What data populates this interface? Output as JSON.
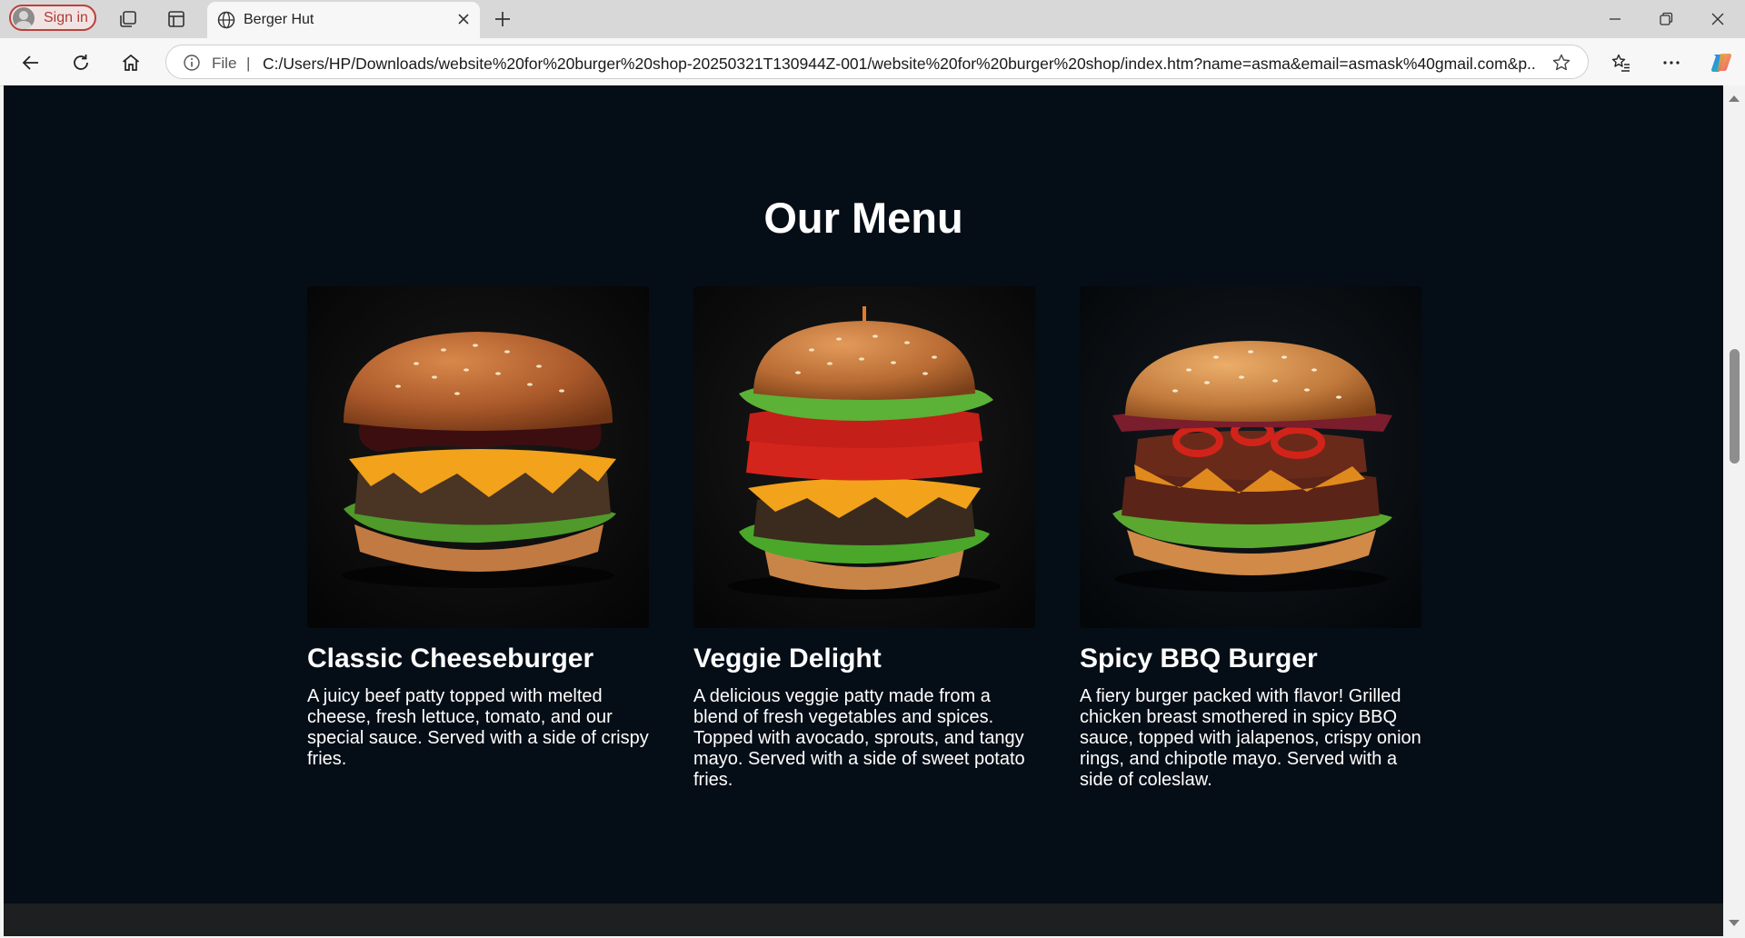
{
  "browser": {
    "profile_label": "Sign in",
    "tab_title": "Berger Hut",
    "address": {
      "scheme_label": "File",
      "separator": "|",
      "url": "C:/Users/HP/Downloads/website%20for%20burger%20shop-20250321T130944Z-001/website%20for%20burger%20shop/index.htm?name=asma&email=asmask%40gmail.com&p..."
    },
    "icons": {
      "workspaces": "workspaces-icon",
      "tab_actions": "vertical-tabs-icon",
      "tab_globe": "globe-icon",
      "tab_close": "close-icon",
      "new_tab": "plus-icon",
      "minimize": "minimize-icon",
      "restore": "restore-icon",
      "close_window": "close-icon",
      "back": "back-arrow-icon",
      "refresh": "refresh-icon",
      "home": "home-icon",
      "info": "info-icon",
      "favorite": "star-icon",
      "favorites": "favorites-icon",
      "more": "more-icon",
      "copilot": "copilot-icon"
    },
    "colors": {
      "signin_accent": "#b8423b",
      "tabstrip": "#d8d8d8",
      "page_background": "#050d16"
    }
  },
  "page": {
    "section_title": "Our Menu",
    "menu_items": [
      {
        "name": "Classic Cheeseburger",
        "description": "A juicy beef patty topped with melted cheese, fresh lettuce, tomato, and our special sauce. Served with a side of crispy fries."
      },
      {
        "name": "Veggie Delight",
        "description": "A delicious veggie patty made from a blend of fresh vegetables and spices. Topped with avocado, sprouts, and tangy mayo. Served with a side of sweet potato fries."
      },
      {
        "name": "Spicy BBQ Burger",
        "description": "A fiery burger packed with flavor! Grilled chicken breast smothered in spicy BBQ sauce, topped with jalapenos, crispy onion rings, and chipotle mayo. Served with a side of coleslaw."
      }
    ]
  }
}
